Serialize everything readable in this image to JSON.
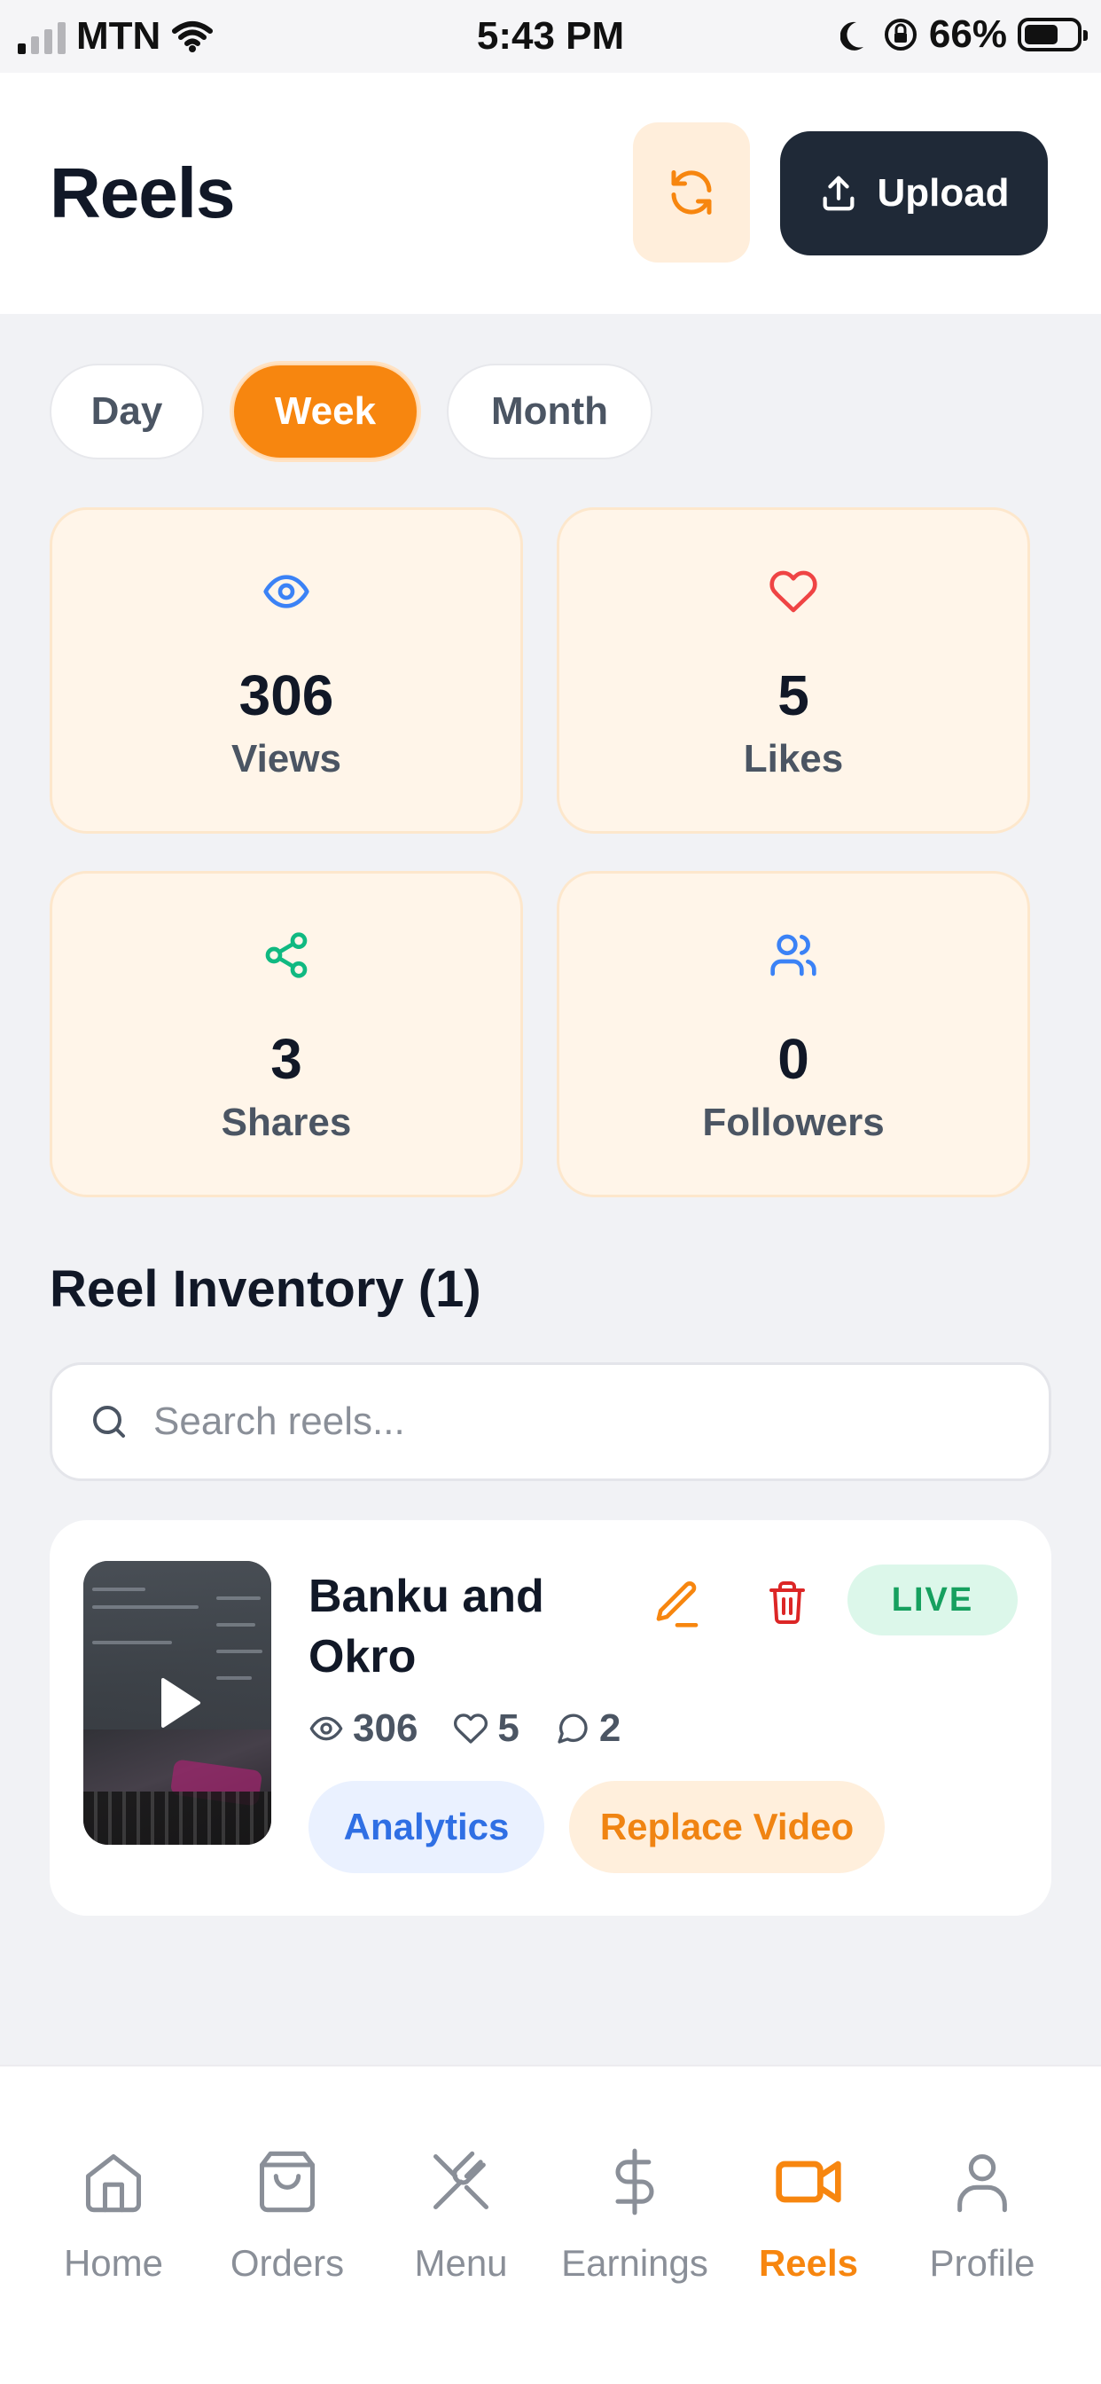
{
  "status_bar": {
    "carrier": "MTN",
    "time": "5:43 PM",
    "battery": "66%"
  },
  "header": {
    "title": "Reels",
    "upload_label": "Upload"
  },
  "period_tabs": {
    "items": [
      "Day",
      "Week",
      "Month"
    ],
    "selected": "Week"
  },
  "stats": [
    {
      "value": "306",
      "label": "Views",
      "icon": "eye-icon",
      "color": "#3b82f6"
    },
    {
      "value": "5",
      "label": "Likes",
      "icon": "heart-icon",
      "color": "#ef4444"
    },
    {
      "value": "3",
      "label": "Shares",
      "icon": "share-icon",
      "color": "#10b981"
    },
    {
      "value": "0",
      "label": "Followers",
      "icon": "users-icon",
      "color": "#3b82f6"
    }
  ],
  "inventory": {
    "title": "Reel Inventory (1)",
    "search_placeholder": "Search reels...",
    "reels": [
      {
        "title": "Banku and Okro",
        "status": "LIVE",
        "views": "306",
        "likes": "5",
        "comments": "2",
        "analytics_label": "Analytics",
        "replace_label": "Replace Video"
      }
    ]
  },
  "bottom_nav": {
    "items": [
      "Home",
      "Orders",
      "Menu",
      "Earnings",
      "Reels",
      "Profile"
    ],
    "active": "Reels"
  },
  "colors": {
    "accent": "#f7860f",
    "dark": "#1f2937",
    "live": "#16a05f"
  }
}
